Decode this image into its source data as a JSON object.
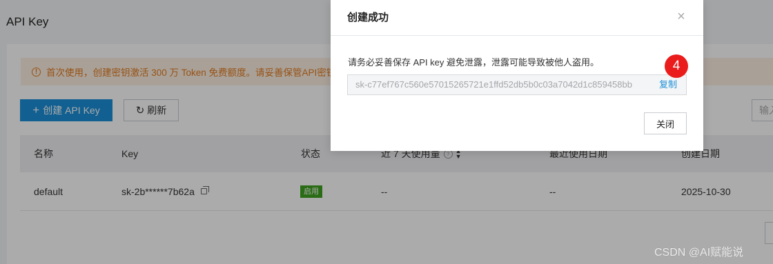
{
  "page": {
    "title": "API Key",
    "notice": "首次使用，创建密钥激活 300 万 Token 免费额度。请妥善保管API密钥",
    "create_button": "创建 API Key",
    "refresh_button": "刷新",
    "search_placeholder": "输入"
  },
  "table": {
    "headers": [
      "名称",
      "Key",
      "状态",
      "近 7 天使用量",
      "最近使用日期",
      "创建日期"
    ],
    "rows": [
      {
        "name": "default",
        "key": "sk-2b******7b62a",
        "status": "启用",
        "usage": "--",
        "last_used": "--",
        "created": "2025-10-30"
      }
    ]
  },
  "modal": {
    "title": "创建成功",
    "message": "请务必妥善保存 API key 避免泄露，泄露可能导致被他人盗用。",
    "key_value": "sk-c77ef767c560e57015265721e1ffd52db5b0c03a7042d1c859458bb",
    "copy_label": "复制",
    "close_button": "关闭",
    "step_badge": "4"
  },
  "watermark": "CSDN @AI赋能说",
  "colors": {
    "primary": "#1c8fd9",
    "warning": "#e27a1f",
    "success": "#3fa220",
    "badge_red": "#ea1c1c"
  }
}
